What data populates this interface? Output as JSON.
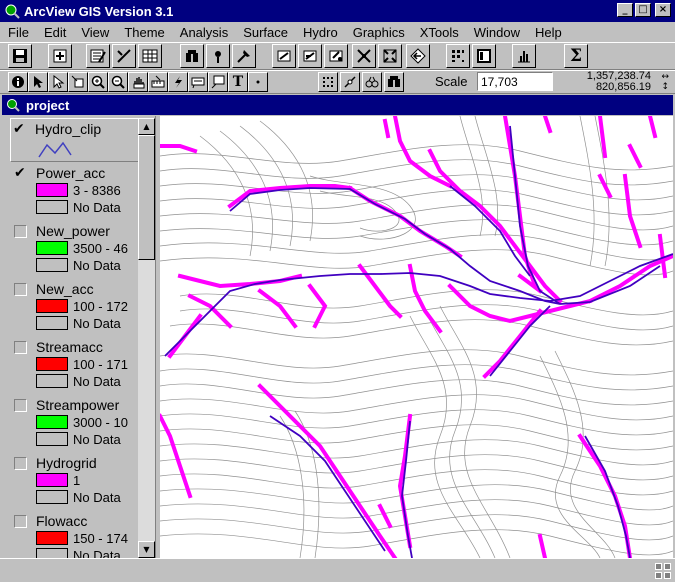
{
  "window": {
    "title": "ArcView GIS Version 3.1",
    "minimize": "_",
    "maximize": "□",
    "close": "×"
  },
  "menu": [
    "File",
    "Edit",
    "View",
    "Theme",
    "Analysis",
    "Surface",
    "Hydro",
    "Graphics",
    "XTools",
    "Window",
    "Help"
  ],
  "toolbar1": {
    "buttons": [
      "save-icon",
      "add-theme-icon",
      "theme-properties-icon",
      "edit-legend-icon",
      "open-table-icon",
      "find-icon",
      "locate-address-icon",
      "query-builder-icon",
      "zoom-full-extent-icon",
      "zoom-to-themes-icon",
      "zoom-to-selected-icon",
      "zoom-in-icon",
      "zoom-out-icon",
      "zoom-previous-icon",
      "select-features-icon",
      "clear-selection-icon",
      "layout-icon",
      "histogram-icon",
      "sum-icon"
    ]
  },
  "toolbar2": {
    "tools": [
      "identify-icon",
      "pointer-icon",
      "vertex-edit-icon",
      "select-feature-icon",
      "zoom-in-tool-icon",
      "zoom-out-tool-icon",
      "pan-icon",
      "measure-icon",
      "hotlink-icon",
      "label-icon",
      "text-icon",
      "draw-point-icon",
      "snap-icon",
      "line-split-icon",
      "drainage-icon",
      "flow-path-icon"
    ],
    "scale_label": "Scale",
    "scale_value": "17,703",
    "coord_x": "1,357,238.74",
    "coord_y": "820,856.19"
  },
  "view": {
    "title": "project"
  },
  "themes": [
    {
      "name": "Hydro_clip",
      "checked": true,
      "active": true,
      "legend": [
        {
          "kind": "line",
          "color": "#4040c0",
          "label": ""
        }
      ]
    },
    {
      "name": "Power_acc",
      "checked": true,
      "legend": [
        {
          "color": "#ff00ff",
          "label": "3 - 8386"
        },
        {
          "color": "#c0c0c0",
          "label": "No Data"
        }
      ]
    },
    {
      "name": "New_power",
      "checked": false,
      "legend": [
        {
          "color": "#00ff00",
          "label": "3500 - 46"
        },
        {
          "color": "#c0c0c0",
          "label": "No Data"
        }
      ]
    },
    {
      "name": "New_acc",
      "checked": false,
      "legend": [
        {
          "color": "#ff0000",
          "label": "100 - 172"
        },
        {
          "color": "#c0c0c0",
          "label": "No Data"
        }
      ]
    },
    {
      "name": "Streamacc",
      "checked": false,
      "legend": [
        {
          "color": "#ff0000",
          "label": "100 - 171"
        },
        {
          "color": "#c0c0c0",
          "label": "No Data"
        }
      ]
    },
    {
      "name": "Streampower",
      "checked": false,
      "legend": [
        {
          "color": "#00ff00",
          "label": "3000 - 10"
        },
        {
          "color": "#c0c0c0",
          "label": "No Data"
        }
      ]
    },
    {
      "name": "Hydrogrid",
      "checked": false,
      "legend": [
        {
          "color": "#ff00ff",
          "label": "1"
        },
        {
          "color": "#c0c0c0",
          "label": "No Data"
        }
      ]
    },
    {
      "name": "Flowacc",
      "checked": false,
      "legend": [
        {
          "color": "#ff0000",
          "label": "150 - 174"
        },
        {
          "color": "#c0c0c0",
          "label": "No Data"
        }
      ]
    }
  ],
  "colors": {
    "titlebar": "#000080",
    "stream_raster": "#ff00ff",
    "stream_line": "#4000c0",
    "contour": "#909090"
  }
}
